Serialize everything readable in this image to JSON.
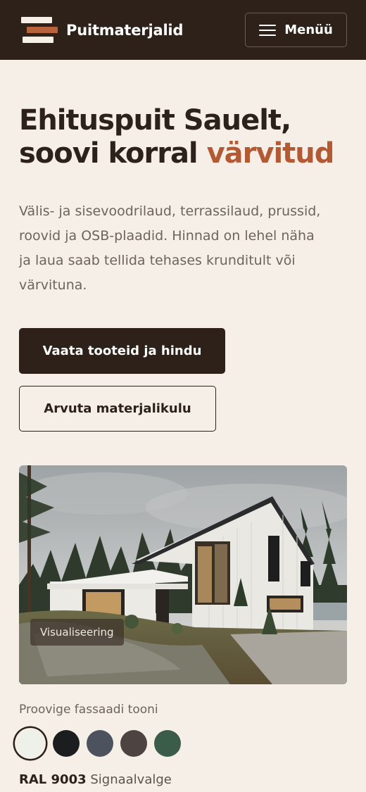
{
  "header": {
    "brand": "Puitmaterjalid",
    "menu_label": "Menüü"
  },
  "hero": {
    "title_line1": "Ehituspuit Sauelt,",
    "title_line2_prefix": "soovi korral ",
    "title_line2_accent": "värvitud",
    "description": "Välis- ja sisevoodrilaud, terrassilaud, prussid, roovid ja OSB-plaadid. Hinnad on lehel näha ja laua saab tellida tehases krunditult või värvituna.",
    "primary_button": "Vaata tooteid ja hindu",
    "secondary_button": "Arvuta materjalikulu"
  },
  "visual": {
    "label": "Visualiseering"
  },
  "facade": {
    "title": "Proovige fassaadi tooni",
    "swatches": [
      {
        "color": "#eef0ea",
        "selected": true
      },
      {
        "color": "#1c1d1f",
        "selected": false
      },
      {
        "color": "#4c535e",
        "selected": false
      },
      {
        "color": "#4d4441",
        "selected": false
      },
      {
        "color": "#3c5c4a",
        "selected": false
      }
    ],
    "selected_code": "RAL 9003",
    "selected_name": "Signaalvalge"
  },
  "colors": {
    "dark": "#2e2119",
    "accent": "#b35a34",
    "background": "#f5efe7"
  }
}
